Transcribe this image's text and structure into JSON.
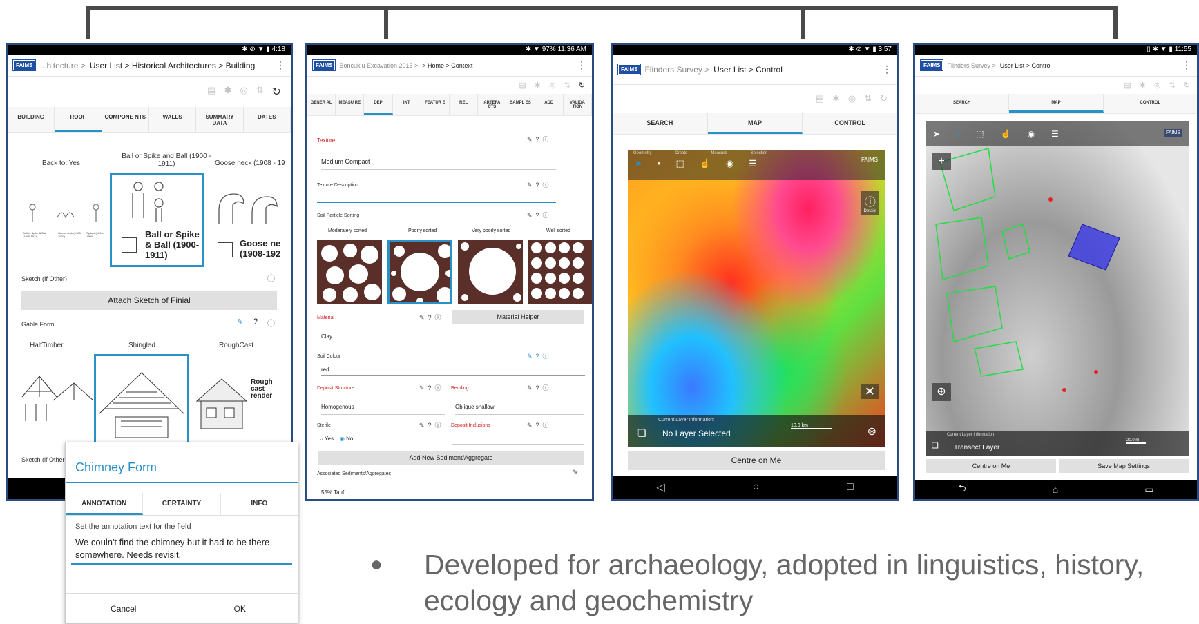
{
  "screen1": {
    "status_time": "4:18",
    "breadcrumb_prefix": "...hitecture > ",
    "breadcrumb": "User List > Historical Architectures > Building",
    "tabs": [
      "BUILDING",
      "ROOF",
      "COMPONE NTS",
      "WALLS",
      "SUMMARY DATA",
      "DATES"
    ],
    "active_tab": "ROOF",
    "back_to": "Back to: Yes",
    "finial_opt1": "Ball or Spike and Ball (1900 - 1911)",
    "finial_opt2": "Goose neck (1908 - 19",
    "finial_sel_text": "Ball or Spike & Ball (1900-1911)",
    "finial_goose_text": "Goose ne (1908-192",
    "mini1": "Ball or Spike & Ball (1900-1911)",
    "mini2": "Goose neck (1908-1920)",
    "mini3": "Spiked (1890-1900)",
    "sketch_label": "Sketch (If Other)",
    "attach_button": "Attach Sketch of Finial",
    "gable_label": "Gable Form",
    "gable_opts": [
      "HalfTimber",
      "Shingled",
      "RoughCast"
    ],
    "rough_text": "Rough cast render",
    "sketch2_label": "Sketch (if Other"
  },
  "dialog": {
    "title": "Chimney Form",
    "tabs": [
      "ANNOTATION",
      "CERTAINTY",
      "INFO"
    ],
    "hint": "Set the annotation text for the field",
    "value": "We couln't find the chimney but it had to be there somewhere. Needs revisit.",
    "cancel": "Cancel",
    "ok": "OK"
  },
  "screen2": {
    "status": "97% 11:36 AM",
    "breadcrumb_prefix": "Boncuklu Excavation 2015 > ",
    "breadcrumb": "> Home > Context",
    "tabs": [
      "GENER AL",
      "MEASU RE",
      "DEP",
      "INT",
      "FEATUR E",
      "REL",
      "ARTEFA CTS",
      "SAMPL ES",
      "ADD",
      "VALIDA TION"
    ],
    "texture_label": "Texture",
    "texture_value": "Medium Compact",
    "texture_desc_label": "Texture Description",
    "sorting_label": "Soil Particle Sorting",
    "sorting_opts": [
      "Moderately sorted",
      "Poorly sorted",
      "Very poorly sorted",
      "Well sorted"
    ],
    "material_label": "Material",
    "material_helper": "Material Helper",
    "material_value": "Clay",
    "colour_label": "Soil Colour",
    "colour_value": "red",
    "deposit_label": "Deposit Structure",
    "bedding_label": "Bedding",
    "deposit_value": "Homogenous",
    "bedding_value": "Oblique shallow",
    "sterile_label": "Sterile",
    "inclusions_label": "Deposit Inclusions",
    "yes": "Yes",
    "no": "No",
    "add_button": "Add New Sediment/Aggregate",
    "assoc_label": "Associated Sediments/Aggregates",
    "assoc_value": "55% Tauf"
  },
  "screen3": {
    "status_time": "3:57",
    "breadcrumb_prefix": "Flinders Survey > ",
    "breadcrumb": "User List > Control",
    "tabs": [
      "SEARCH",
      "MAP",
      "CONTROL"
    ],
    "active_tab": "MAP",
    "toolbar_groups": [
      "Geometry",
      "Create",
      "Measure",
      "Selection"
    ],
    "toolbar_items": [
      "Select",
      "Point",
      "Area",
      "Touch",
      "Tracker",
      "Config"
    ],
    "corner_logo": "FAIMS",
    "details": "Details",
    "layer_caption": "Current Layer Information:",
    "layer_name": "No Layer Selected",
    "scale": "10.0 km",
    "centre_button": "Centre on Me"
  },
  "screen4": {
    "status_time": "11:55",
    "breadcrumb_prefix": "Flinders Survey > ",
    "breadcrumb": "User List > Control",
    "tabs": [
      "SEARCH",
      "MAP",
      "CONTROL"
    ],
    "active_tab": "MAP",
    "layer_caption": "Current Layer Information:",
    "layer_name": "Transect Layer",
    "scale": "20.0 m",
    "centre_button": "Centre on Me",
    "save_button": "Save Map Settings",
    "corner_logo": "FAIMS"
  },
  "bullet": "Developed for archaeology, adopted in linguistics, history, ecology and geochemistry",
  "colors": {
    "accent": "#2a91c7",
    "frame": "#2b4c83",
    "faims": "#1e4fa3",
    "required": "#d32020"
  }
}
